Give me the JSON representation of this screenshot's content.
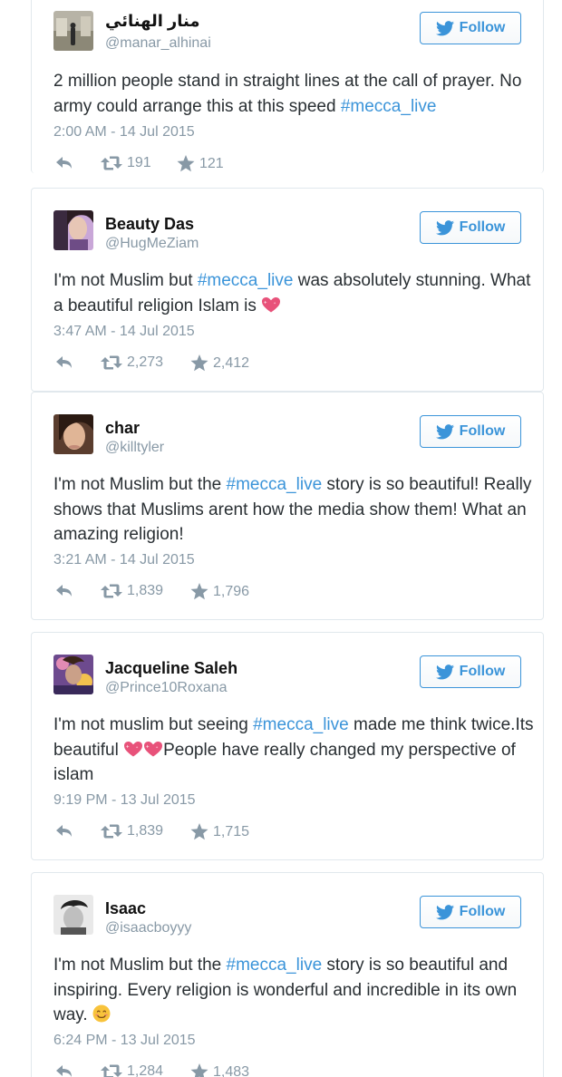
{
  "colors": {
    "accent": "#3b94d9",
    "muted": "#8899a6",
    "text": "#292f33",
    "heart": "#e8527a"
  },
  "follow_label": "Follow",
  "icons": {
    "follow": "twitter-bird-icon",
    "reply": "reply-icon",
    "retweet": "retweet-icon",
    "favorite": "star-icon"
  },
  "tweets": [
    {
      "name": "منار الهنائي",
      "handle": "@manar_alhinai",
      "text_pre": "2 million people stand in straight lines at the call of prayer. No army could arrange this at this speed ",
      "hashtag": "#mecca_live",
      "text_post": "",
      "timestamp": "2:00 AM - 14 Jul 2015",
      "retweets": "191",
      "favorites": "121"
    },
    {
      "name": "Beauty Das",
      "handle": "@HugMeZiam",
      "text_pre": "I'm not Muslim but ",
      "hashtag": "#mecca_live",
      "text_post": " was absolutely stunning. What a beautiful religion Islam is ",
      "emoji": "sparkling-heart",
      "timestamp": "3:47 AM - 14 Jul 2015",
      "retweets": "2,273",
      "favorites": "2,412"
    },
    {
      "name": "char",
      "handle": "@killtyler",
      "text_pre": "I'm not Muslim but the ",
      "hashtag": "#mecca_live",
      "text_post": " story is so beautiful! Really shows that Muslims arent how the media show them! What an amazing religion!",
      "timestamp": "3:21 AM - 14 Jul 2015",
      "retweets": "1,839",
      "favorites": "1,796"
    },
    {
      "name": "Jacqueline Saleh",
      "handle": "@Prince10Roxana",
      "text_pre": "I'm not muslim but seeing ",
      "hashtag": "#mecca_live",
      "text_mid": " made me think twice.Its beautiful ",
      "emoji": "sparkling-heart-pair",
      "text_post": "People have really changed my perspective of islam",
      "timestamp": "9:19 PM - 13 Jul 2015",
      "retweets": "1,839",
      "favorites": "1,715"
    },
    {
      "name": "Isaac",
      "handle": "@isaacboyyy",
      "text_pre": "I'm not Muslim but the ",
      "hashtag": "#mecca_live",
      "text_post": " story is so beautiful and inspiring. Every religion is wonderful and incredible in its own way. ",
      "emoji": "smiling-face",
      "timestamp": "6:24 PM - 13 Jul 2015",
      "retweets": "1,284",
      "favorites": "1,483"
    }
  ]
}
